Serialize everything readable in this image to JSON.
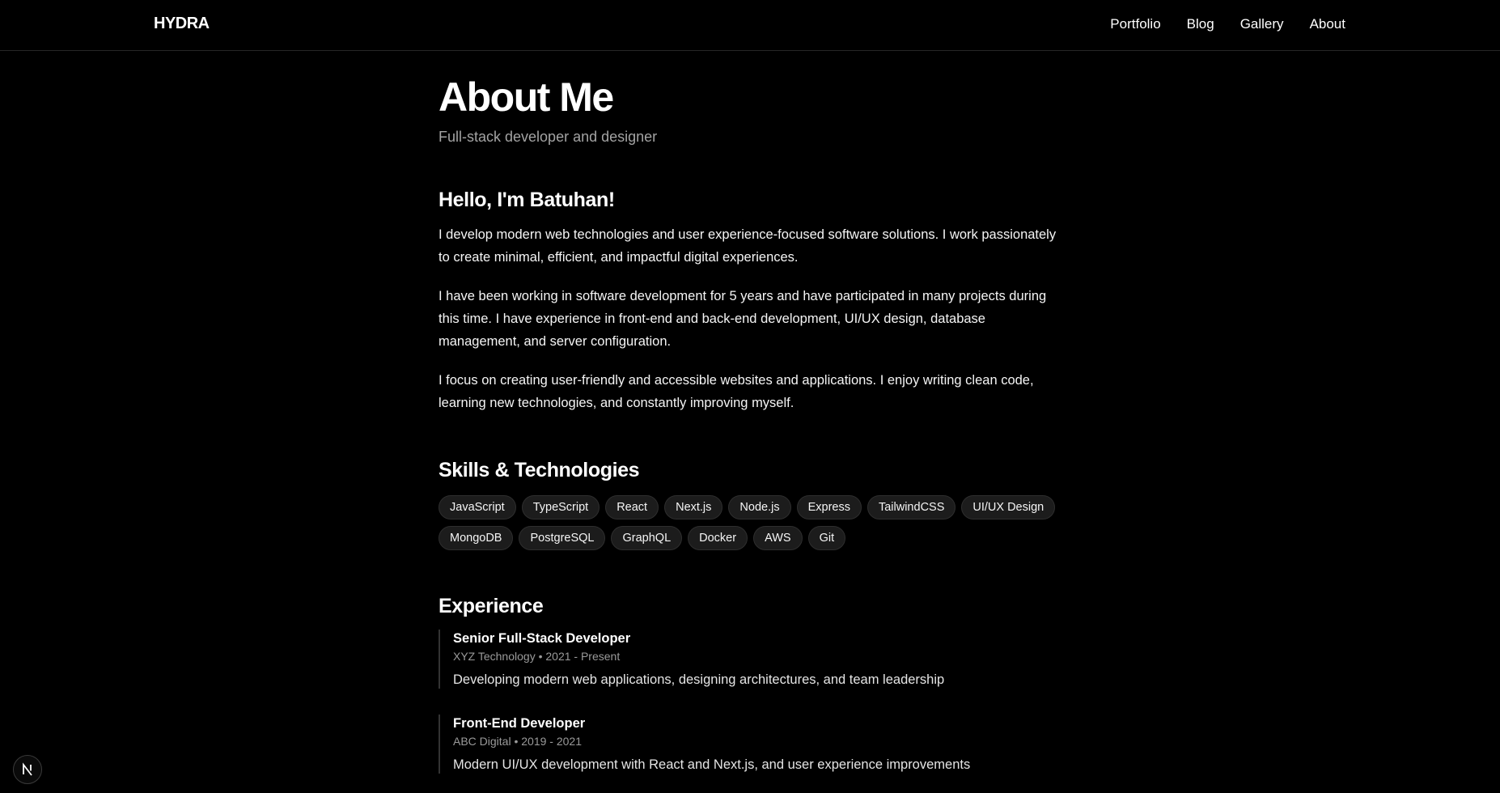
{
  "header": {
    "brand": "HYDRA",
    "nav": [
      "Portfolio",
      "Blog",
      "Gallery",
      "About"
    ]
  },
  "page": {
    "title": "About Me",
    "subtitle": "Full-stack developer and designer"
  },
  "intro": {
    "heading": "Hello, I'm Batuhan!",
    "paragraphs": [
      "I develop modern web technologies and user experience-focused software solutions. I work passionately to create minimal, efficient, and impactful digital experiences.",
      "I have been working in software development for 5 years and have participated in many projects during this time. I have experience in front-end and back-end development, UI/UX design, database management, and server configuration.",
      "I focus on creating user-friendly and accessible websites and applications. I enjoy writing clean code, learning new technologies, and constantly improving myself."
    ]
  },
  "skills": {
    "heading": "Skills & Technologies",
    "items": [
      "JavaScript",
      "TypeScript",
      "React",
      "Next.js",
      "Node.js",
      "Express",
      "TailwindCSS",
      "UI/UX Design",
      "MongoDB",
      "PostgreSQL",
      "GraphQL",
      "Docker",
      "AWS",
      "Git"
    ]
  },
  "experience": {
    "heading": "Experience",
    "jobs": [
      {
        "role": "Senior Full-Stack Developer",
        "meta": "XYZ Technology • 2021 - Present",
        "desc": "Developing modern web applications, designing architectures, and team leadership"
      },
      {
        "role": "Front-End Developer",
        "meta": "ABC Digital • 2019 - 2021",
        "desc": "Modern UI/UX development with React and Next.js, and user experience improvements"
      }
    ]
  },
  "badge": {
    "icon": "nextjs-logo-icon"
  },
  "colors": {
    "background": "#000000",
    "text": "#ffffff",
    "muted": "#a3a3a3",
    "chip_bg": "#1c1c1c"
  }
}
